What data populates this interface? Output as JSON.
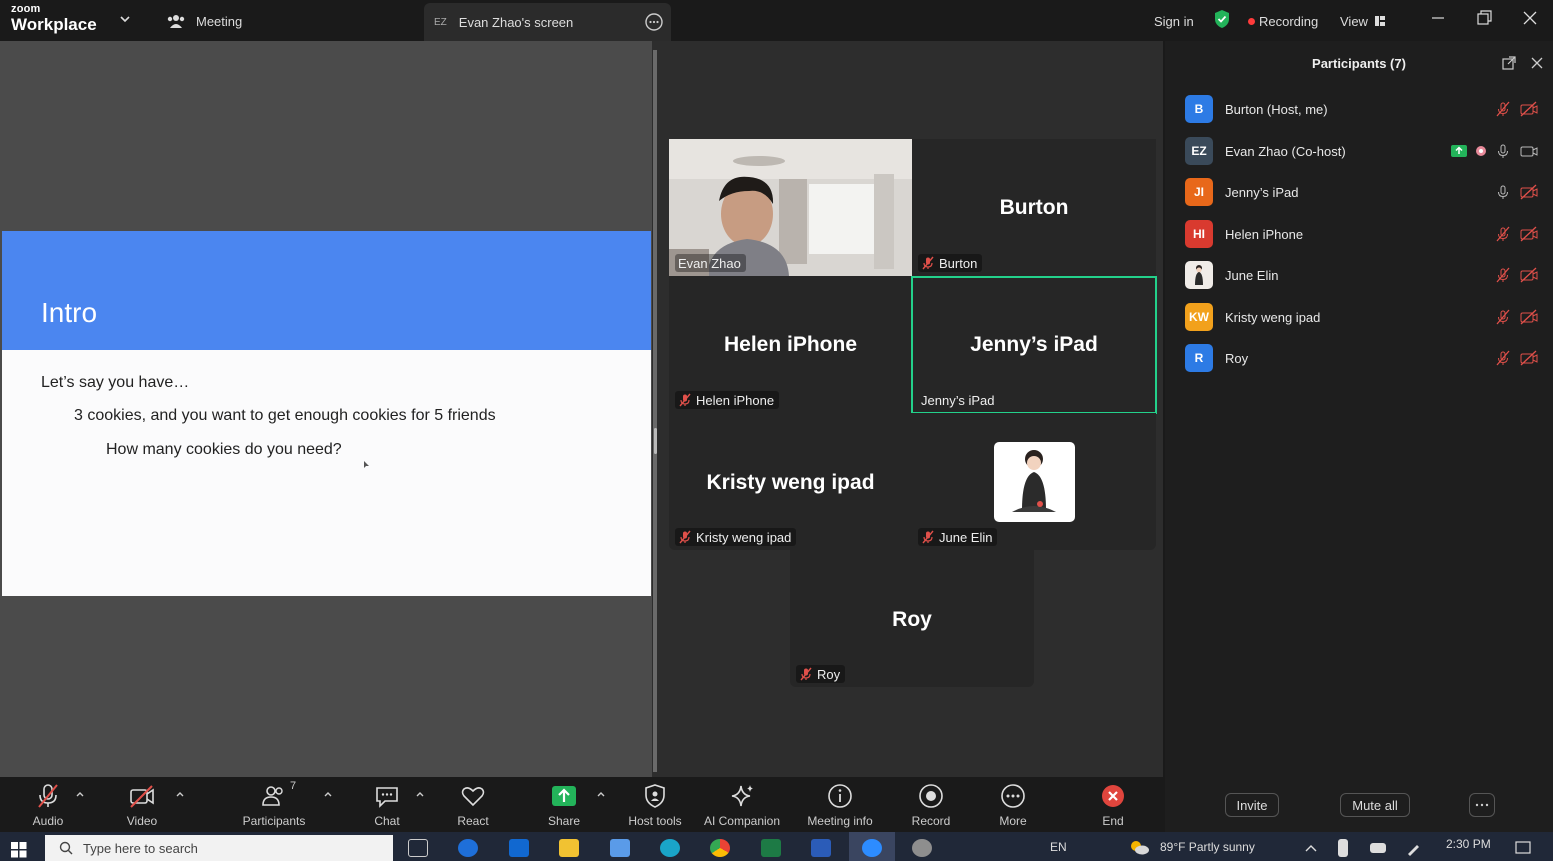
{
  "app": {
    "brand_small": "zoom",
    "brand_big": "Workplace"
  },
  "topbar": {
    "meeting_label": "Meeting",
    "screen_tab_initials": "EZ",
    "screen_tab_label": "Evan Zhao's screen",
    "sign_in": "Sign in",
    "recording": "Recording",
    "view": "View"
  },
  "slide": {
    "title": "Intro",
    "line1": "Let’s say you have…",
    "line2": "3 cookies, and you want to get enough cookies for 5 friends",
    "line3": "How many cookies do you need?"
  },
  "gallery": {
    "evan_label": "Evan Zhao",
    "burton_big": "Burton",
    "burton_label": "Burton",
    "helen_big": "Helen iPhone",
    "helen_label": "Helen iPhone",
    "jenny_big": "Jenny’s iPad",
    "jenny_label": "Jenny’s iPad",
    "kristy_big": "Kristy weng ipad",
    "kristy_label": "Kristy weng ipad",
    "june_label": "June Elin",
    "roy_big": "Roy",
    "roy_label": "Roy"
  },
  "participants": {
    "title": "Participants (7)",
    "list": [
      {
        "initials": "B",
        "name": "Burton (Host, me)",
        "color": "#2d7be5"
      },
      {
        "initials": "EZ",
        "name": "Evan Zhao (Co-host)",
        "color": "#3a4a5a"
      },
      {
        "initials": "JI",
        "name": "Jenny’s iPad",
        "color": "#e8681a"
      },
      {
        "initials": "HI",
        "name": "Helen iPhone",
        "color": "#d93a2f"
      },
      {
        "initials": "",
        "name": "June Elin",
        "color": "#f0ece8"
      },
      {
        "initials": "KW",
        "name": "Kristy weng ipad",
        "color": "#f2a11c"
      },
      {
        "initials": "R",
        "name": "Roy",
        "color": "#2d7be5"
      }
    ],
    "invite": "Invite",
    "mute_all": "Mute all"
  },
  "toolbar": {
    "audio": "Audio",
    "video": "Video",
    "participants": "Participants",
    "participants_count": "7",
    "chat": "Chat",
    "react": "React",
    "share": "Share",
    "host_tools": "Host tools",
    "ai_companion": "AI Companion",
    "meeting_info": "Meeting info",
    "record": "Record",
    "more": "More",
    "end": "End"
  },
  "taskbar": {
    "search_placeholder": "Type here to search",
    "lang": "EN",
    "weather": "89°F  Partly sunny",
    "time": "2:30 PM"
  },
  "colors": {
    "accent_green": "#23d18b",
    "slide_blue": "#4b86f0",
    "mute_red": "#e0504a"
  }
}
